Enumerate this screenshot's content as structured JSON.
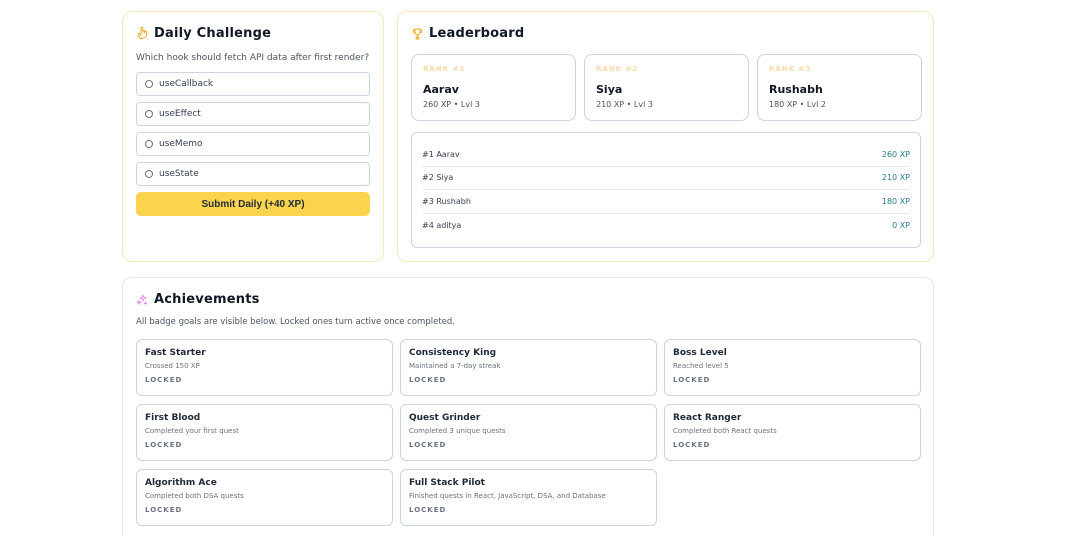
{
  "daily": {
    "icon": "hand-point-up-icon",
    "title": "Daily Challenge",
    "question": "Which hook should fetch API data after first render?",
    "options": [
      "useCallback",
      "useEffect",
      "useMemo",
      "useState"
    ],
    "submit_label": "Submit Daily (+40 XP)"
  },
  "leaderboard": {
    "icon": "trophy-icon",
    "title": "Leaderboard",
    "podium": [
      {
        "rank": "RANK #1",
        "name": "Aarav",
        "meta": "260 XP • Lvl 3"
      },
      {
        "rank": "RANK #2",
        "name": "Siya",
        "meta": "210 XP • Lvl 3"
      },
      {
        "rank": "RANK #3",
        "name": "Rushabh",
        "meta": "180 XP • Lvl 2"
      }
    ],
    "rows": [
      {
        "name": "#1 Aarav",
        "xp": "260 XP"
      },
      {
        "name": "#2 Siya",
        "xp": "210 XP"
      },
      {
        "name": "#3 Rushabh",
        "xp": "180 XP"
      },
      {
        "name": "#4 aditya",
        "xp": "0 XP"
      }
    ]
  },
  "achievements": {
    "icon": "sparkles-icon",
    "title": "Achievements",
    "subtitle": "All badge goals are visible below. Locked ones turn active once completed.",
    "badges": [
      {
        "title": "Fast Starter",
        "desc": "Crossed 150 XP",
        "state": "LOCKED"
      },
      {
        "title": "Consistency King",
        "desc": "Maintained a 7-day streak",
        "state": "LOCKED"
      },
      {
        "title": "Boss Level",
        "desc": "Reached level 5",
        "state": "LOCKED"
      },
      {
        "title": "First Blood",
        "desc": "Completed your first quest",
        "state": "LOCKED"
      },
      {
        "title": "Quest Grinder",
        "desc": "Completed 3 unique quests",
        "state": "LOCKED"
      },
      {
        "title": "React Ranger",
        "desc": "Completed both React quests",
        "state": "LOCKED"
      },
      {
        "title": "Algorithm Ace",
        "desc": "Completed both DSA quests",
        "state": "LOCKED"
      },
      {
        "title": "Full Stack Pilot",
        "desc": "Finished quests in React, JavaScript, DSA, and Database",
        "state": "LOCKED"
      }
    ]
  },
  "colors": {
    "accent": "#fcd34d",
    "xp_text": "#2a7f8f",
    "card_border_warm": "#f6e9b5"
  }
}
